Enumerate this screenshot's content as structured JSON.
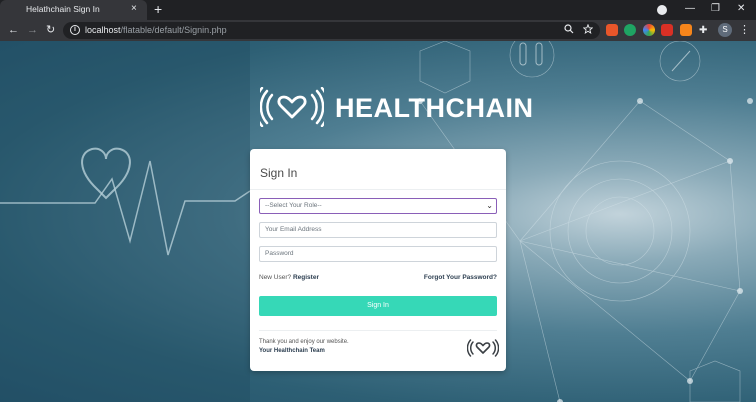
{
  "browser": {
    "tab_title": "Helathchain Sign In",
    "tab_close": "×",
    "new_tab": "+",
    "url_host": "localhost",
    "url_path": "/flatable/default/Signin.php",
    "back": "←",
    "forward": "→",
    "reload": "↻",
    "zoom_icon": "search-icon",
    "star_icon": "star-icon",
    "profile_initial": "S",
    "menu": "⋮",
    "minimize": "—",
    "maximize": "❐",
    "close": "✕"
  },
  "brand": {
    "name": "HEALTHCHAIN"
  },
  "login": {
    "title": "Sign In",
    "role_placeholder": "--Select Your Role--",
    "email_placeholder": "Your Email Address",
    "password_placeholder": "Password",
    "new_user_text": "New User?",
    "register_label": "Register",
    "forgot_label": "Forgot Your Password?",
    "signin_label": "Sign In",
    "thanks_text": "Thank you and enjoy our website.",
    "team_text": "Your Healthchain Team"
  },
  "colors": {
    "accent": "#36d8b7",
    "brand_text": "#ffffff",
    "link": "#2c3e50"
  }
}
